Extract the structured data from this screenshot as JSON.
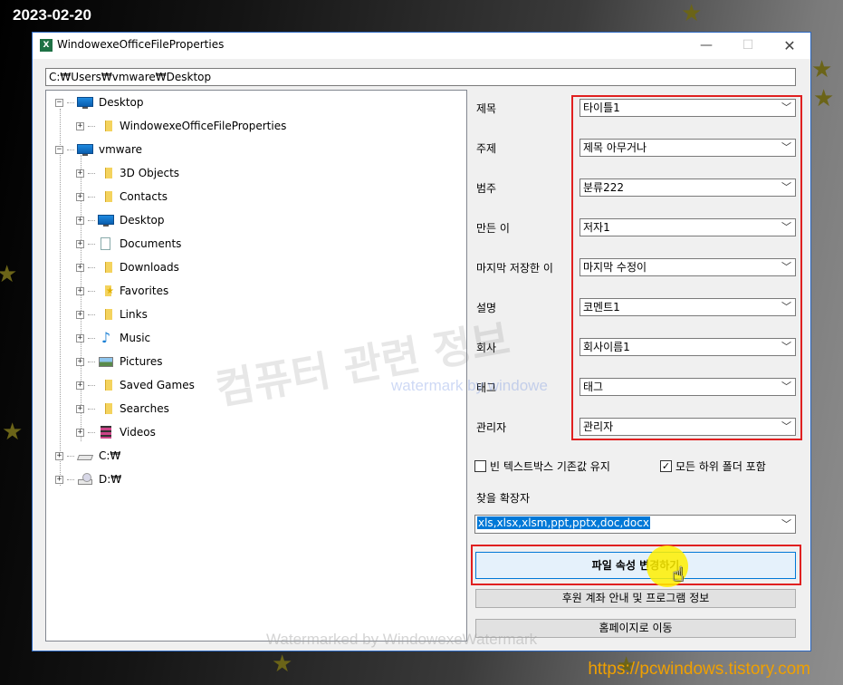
{
  "overlay": {
    "date": "2023-02-20",
    "site": "https://pcwindows.tistory.com",
    "watermark_big": "컴퓨터 관련 정보",
    "watermark_blue": "watermark by windowe",
    "watermark_bottom": "Watermarked by WindowexeWatermark"
  },
  "window": {
    "title": "WindowexeOfficeFileProperties",
    "icon_letter": "X",
    "minimize_glyph": "—",
    "maximize_glyph": "☐",
    "close_glyph": "✕"
  },
  "path": {
    "value": "C:₩Users₩vmware₩Desktop"
  },
  "tree": {
    "items": [
      {
        "label": "Desktop",
        "icon": "monitor"
      },
      {
        "label": "WindowexeOfficeFileProperties",
        "icon": "folder"
      },
      {
        "label": "vmware",
        "icon": "monitor"
      },
      {
        "label": "3D Objects",
        "icon": "folder"
      },
      {
        "label": "Contacts",
        "icon": "folder"
      },
      {
        "label": "Desktop",
        "icon": "monitor"
      },
      {
        "label": "Documents",
        "icon": "doc"
      },
      {
        "label": "Downloads",
        "icon": "folder"
      },
      {
        "label": "Favorites",
        "icon": "star-folder"
      },
      {
        "label": "Links",
        "icon": "folder"
      },
      {
        "label": "Music",
        "icon": "music"
      },
      {
        "label": "Pictures",
        "icon": "pictures"
      },
      {
        "label": "Saved Games",
        "icon": "folder"
      },
      {
        "label": "Searches",
        "icon": "folder"
      },
      {
        "label": "Videos",
        "icon": "video"
      },
      {
        "label": "C:₩",
        "icon": "drive"
      },
      {
        "label": "D:₩",
        "icon": "dvd"
      }
    ],
    "expand_plus": "+",
    "expand_minus": "−"
  },
  "properties": [
    {
      "label": "제목",
      "value": "타이틀1"
    },
    {
      "label": "주제",
      "value": "제목 아무거나"
    },
    {
      "label": "범주",
      "value": "분류222"
    },
    {
      "label": "만든 이",
      "value": "저자1"
    },
    {
      "label": "마지막 저장한 이",
      "value": "마지막 수정이"
    },
    {
      "label": "설명",
      "value": "코멘트1"
    },
    {
      "label": "회사",
      "value": "회사이름1"
    },
    {
      "label": "태그",
      "value": "태그"
    },
    {
      "label": "관리자",
      "value": "관리자"
    }
  ],
  "options": {
    "keep_blank": {
      "label": "빈 텍스트박스 기존값 유지",
      "checked": false
    },
    "include_sub": {
      "label": "모든 하위 폴더 포함",
      "checked": true,
      "check_glyph": "✓"
    }
  },
  "extensions": {
    "label": "찾을 확장자",
    "value": "xls,xlsx,xlsm,ppt,pptx,doc,docx"
  },
  "buttons": {
    "apply": "파일 속성 변경하기",
    "donate": "후원 계좌 안내 및 프로그램 정보",
    "homepage": "홈페이지로 이동"
  },
  "icons": {
    "dropdown": "﹀",
    "cursor": "☝"
  },
  "colors": {
    "highlight": "#e02020",
    "accent": "#0078d7",
    "link": "#f0a000"
  }
}
